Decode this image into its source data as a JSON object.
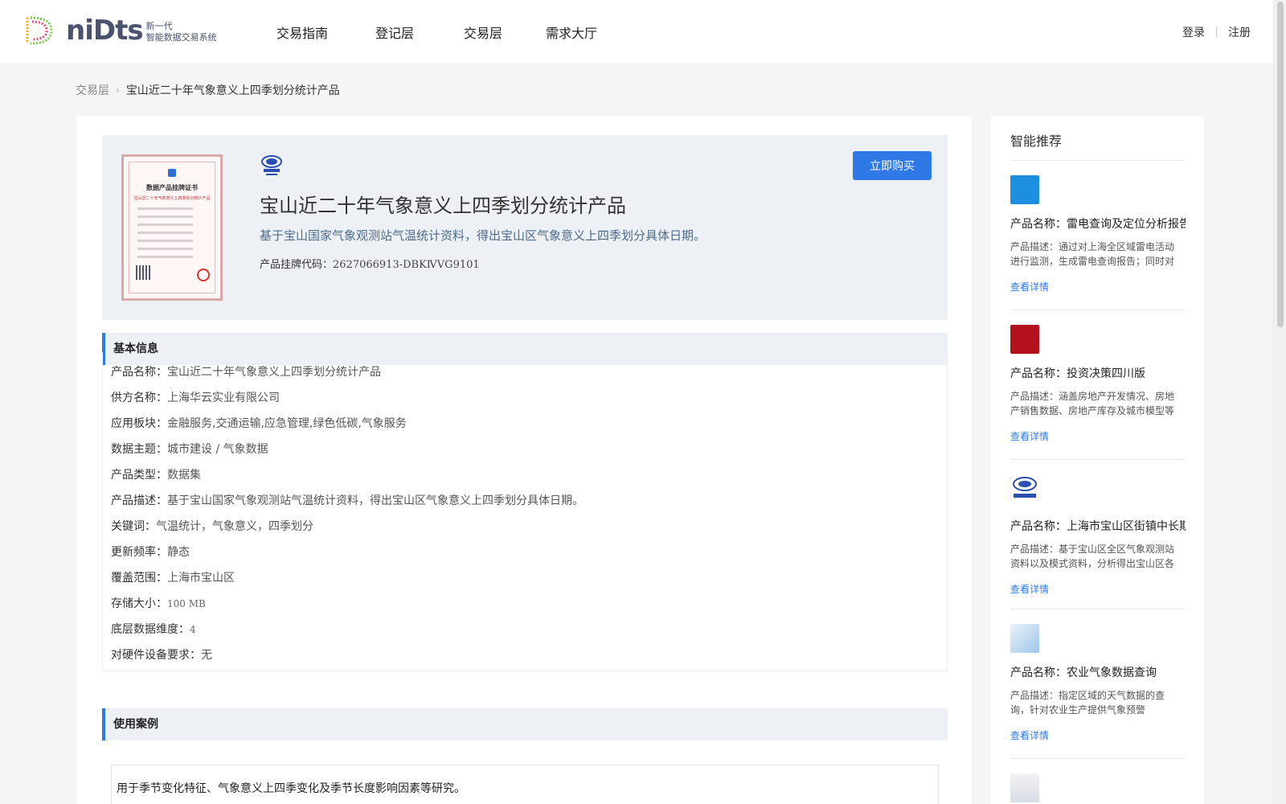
{
  "header": {
    "logo_text": "niDts",
    "logo_sub_line1": "新一代",
    "logo_sub_line2": "智能数据交易系统",
    "nav": [
      "交易指南",
      "登记层",
      "交易层",
      "需求大厅"
    ],
    "login": "登录",
    "register": "注册"
  },
  "breadcrumb": {
    "parent": "交易层",
    "current": "宝山近二十年气象意义上四季划分统计产品"
  },
  "product": {
    "title": "宝山近二十年气象意义上四季划分统计产品",
    "description": "基于宝山国家气象观测站气温统计资料，得出宝山区气象意义上四季划分具体日期。",
    "code_label": "产品挂牌代码：",
    "code_value": "2627066913-DBKⅣVG9101",
    "buy_button": "立即购买",
    "certificate_title": "数据产品挂牌证书",
    "certificate_subtitle": "宝山近二十年气象意义上四季划分统计产品"
  },
  "basic_info": {
    "heading": "基本信息",
    "rows": [
      {
        "key": "产品名称：",
        "value": "宝山近二十年气象意义上四季划分统计产品"
      },
      {
        "key": "供方名称：",
        "value": "上海华云实业有限公司"
      },
      {
        "key": "应用板块：",
        "value": "金融服务,交通运输,应急管理,绿色低碳,气象服务"
      },
      {
        "key": "数据主题：",
        "value": "城市建设 / 气象数据"
      },
      {
        "key": "产品类型：",
        "value": "数据集"
      },
      {
        "key": "产品描述：",
        "value": "基于宝山国家气象观测站气温统计资料，得出宝山区气象意义上四季划分具体日期。"
      },
      {
        "key": "关键词：",
        "value": "气温统计，气象意义，四季划分"
      },
      {
        "key": "更新频率：",
        "value": "静态"
      },
      {
        "key": "覆盖范围：",
        "value": "上海市宝山区"
      },
      {
        "key": "存储大小：",
        "value": "100 MB"
      },
      {
        "key": "底层数据维度：",
        "value": "4"
      },
      {
        "key": "对硬件设备要求：",
        "value": "无"
      }
    ]
  },
  "use_cases": {
    "heading": "使用案例",
    "text": "用于季节变化特征、气象意义上四季变化及季节长度影响因素等研究。"
  },
  "sidebar": {
    "title": "智能推荐",
    "link_label": "查看详情",
    "items": [
      {
        "name": "产品名称：雷电查询及定位分析报告",
        "desc": "产品描述：通过对上海全区域雷电活动进行监测，生成雷电查询报告；同时对雷电定位数据进行分析",
        "thumb_color": "#1e8fe0"
      },
      {
        "name": "产品名称：投资决策四川版",
        "desc": "产品描述：涵盖房地产开发情况、房地产销售数据、房地产库存及城市模型等数据",
        "thumb_color": "#b3121c"
      },
      {
        "name": "产品名称：上海市宝山区街镇中长期",
        "desc": "产品描述：基于宝山区全区气象观测站资料以及模式资料，分析得出宝山区各街镇气候特征",
        "thumb_color": "#2a4fb0"
      },
      {
        "name": "产品名称：农业气象数据查询",
        "desc": "产品描述：指定区域的天气数据的查询，针对农业生产提供气象预警",
        "thumb_color": "#9fc6e8"
      }
    ]
  }
}
